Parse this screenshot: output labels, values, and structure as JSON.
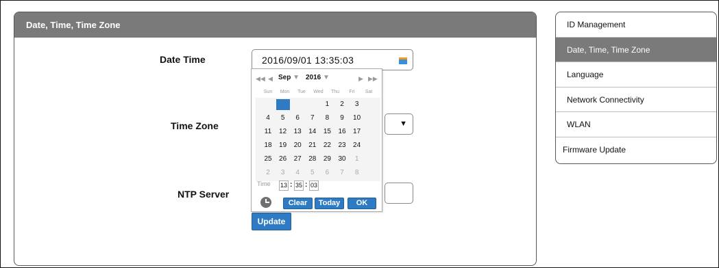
{
  "panel": {
    "title": "Date, Time, Time Zone"
  },
  "fields": {
    "date_time": {
      "label": "Date Time",
      "value": "2016/09/01  13:35:03",
      "icon": "calendar-icon"
    },
    "time_zone": {
      "label": "Time Zone",
      "icon": "dropdown-arrow-icon",
      "arrow": "▼"
    },
    "ntp_server": {
      "label": "NTP Server",
      "value": ""
    },
    "update_label": "Update"
  },
  "calendar": {
    "nav_first": "◀◀",
    "nav_prev": "◀",
    "month": "Sep",
    "year": "2016",
    "caret": "▼",
    "nav_next": "▶",
    "nav_last": "▶▶",
    "weekdays": [
      "Sun",
      "Mon",
      "Tue",
      "Wed",
      "Thu",
      "Fri",
      "Sat"
    ],
    "weeks": [
      [
        "",
        "",
        "",
        "",
        "1",
        "2",
        "3"
      ],
      [
        "4",
        "5",
        "6",
        "7",
        "8",
        "9",
        "10"
      ],
      [
        "11",
        "12",
        "13",
        "14",
        "15",
        "16",
        "17"
      ],
      [
        "18",
        "19",
        "20",
        "21",
        "22",
        "23",
        "24"
      ],
      [
        "25",
        "26",
        "27",
        "28",
        "29",
        "30",
        "1"
      ],
      [
        "2",
        "3",
        "4",
        "5",
        "6",
        "7",
        "8"
      ]
    ],
    "time_label": "Time",
    "hour": "13",
    "minute": "35",
    "second": "03",
    "colon": ":",
    "clear_label": "Clear",
    "today_label": "Today",
    "ok_label": "OK",
    "clock_icon": "clock-icon"
  },
  "sidebar": {
    "items": [
      {
        "label": "ID Management",
        "active": false
      },
      {
        "label": "Date, Time, Time Zone",
        "active": true
      },
      {
        "label": "Language",
        "active": false
      },
      {
        "label": "Network Connectivity",
        "active": false
      },
      {
        "label": "WLAN",
        "active": false
      },
      {
        "label": "Firmware Update",
        "active": false
      }
    ]
  },
  "colors": {
    "header_gray": "#7a7a7a",
    "accent_blue": "#2e7bc4"
  }
}
